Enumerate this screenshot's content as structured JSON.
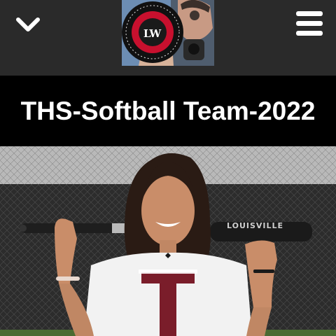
{
  "header": {
    "menu_toggle_icon": "chevron-down-icon",
    "nav_icon": "hamburger-menu-icon",
    "logo": {
      "initials": "LW",
      "ring_text": "lifeworks media and photography"
    }
  },
  "page": {
    "title": "THS-Softball Team-2022"
  },
  "photo": {
    "bat_brand": "LOUISVILLE"
  },
  "colors": {
    "topbar": "#2a2a2a",
    "title_band": "#000000",
    "title_text": "#ffffff",
    "jersey_letter": "#7a1d2a"
  }
}
